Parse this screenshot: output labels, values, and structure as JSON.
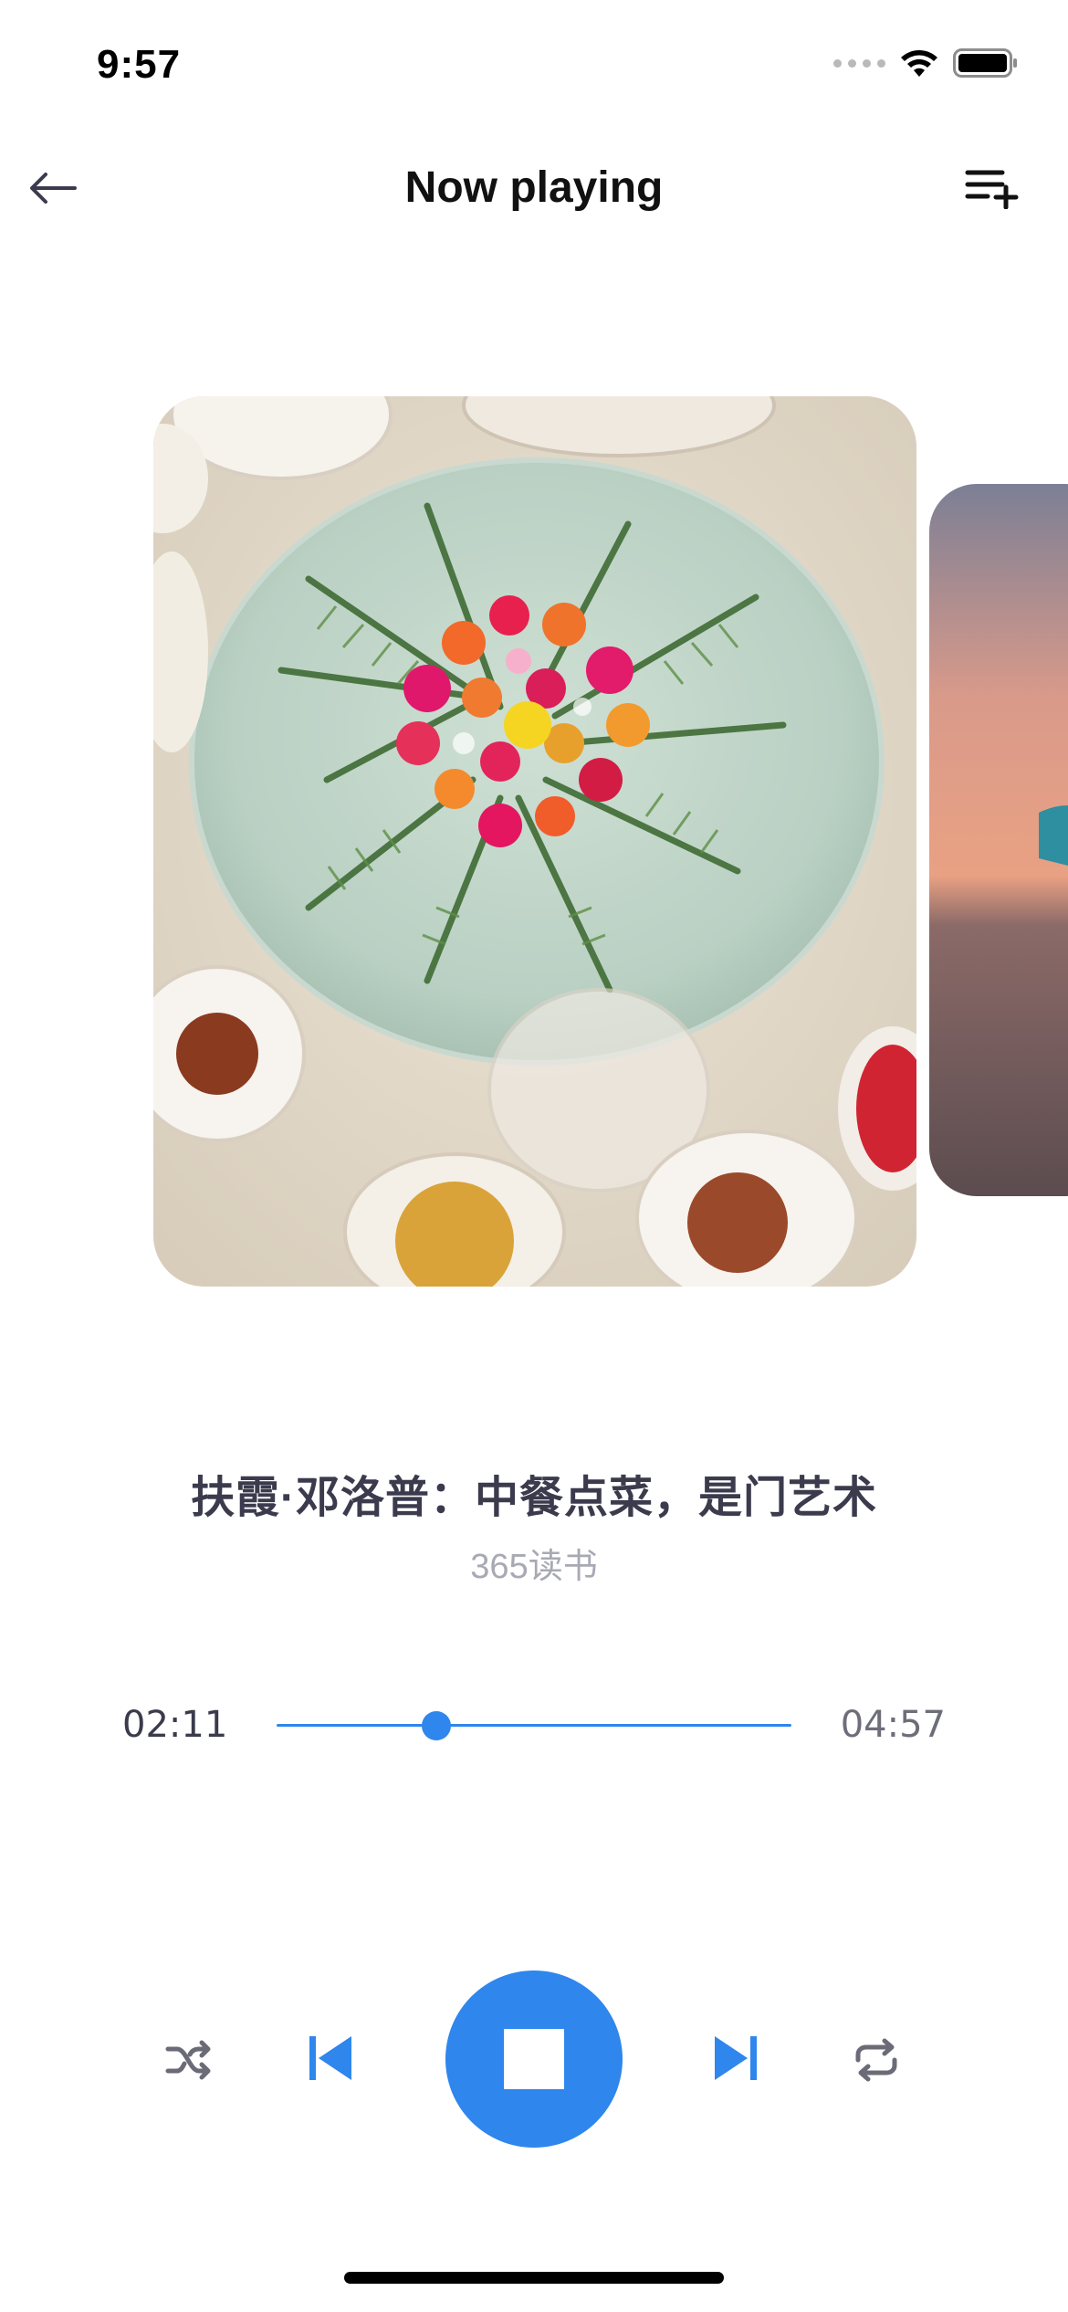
{
  "status_bar": {
    "time": "9:57",
    "icons": [
      "cellular-signal-icon",
      "wifi-icon",
      "battery-icon"
    ]
  },
  "header": {
    "title": "Now playing",
    "back_icon": "arrow-left-icon",
    "queue_icon": "playlist-add-icon"
  },
  "track": {
    "title": "扶霞·邓洛普：中餐点菜，是门艺术",
    "artist": "365读书"
  },
  "progress": {
    "elapsed": "02:11",
    "total": "04:57",
    "fraction": 0.31
  },
  "controls": {
    "shuffle_icon": "shuffle-icon",
    "previous_icon": "skip-previous-icon",
    "play_state_icon": "stop-icon",
    "next_icon": "skip-next-icon",
    "repeat_icon": "repeat-icon"
  },
  "colors": {
    "accent": "#2f86ec",
    "title_text": "#3b3b4d",
    "secondary_text": "#a9a9b4"
  }
}
